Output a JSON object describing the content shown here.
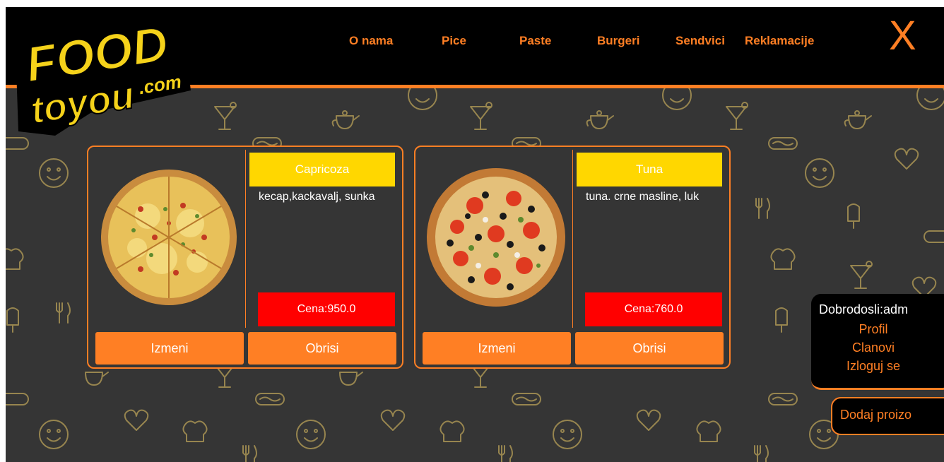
{
  "logo": {
    "line1": "FOOD",
    "line2": "toyou",
    "suffix": ".com"
  },
  "nav": {
    "items": [
      "O nama",
      "Pice",
      "Paste",
      "Burgeri",
      "Sendvici",
      "Reklamacije"
    ],
    "close_label": "X"
  },
  "products": [
    {
      "name": "Capricoza",
      "description": "kecap,kackavalj, sunka",
      "price": "Cena:950.0",
      "edit_label": "Izmeni",
      "delete_label": "Obrisi"
    },
    {
      "name": "Tuna",
      "description": "tuna. crne masline, luk",
      "price": "Cena:760.0",
      "edit_label": "Izmeni",
      "delete_label": "Obrisi"
    }
  ],
  "user_panel": {
    "greeting": "Dobrodosli:adm",
    "links": [
      "Profil",
      "Clanovi",
      "Izloguj se"
    ]
  },
  "add_product_label": "Dodaj proizo",
  "colors": {
    "accent": "#ff7f24",
    "header": "#000000",
    "background": "#353535",
    "name_band": "#ffd700",
    "price_band": "#ff0000",
    "logo_yellow": "#f5d21a"
  }
}
